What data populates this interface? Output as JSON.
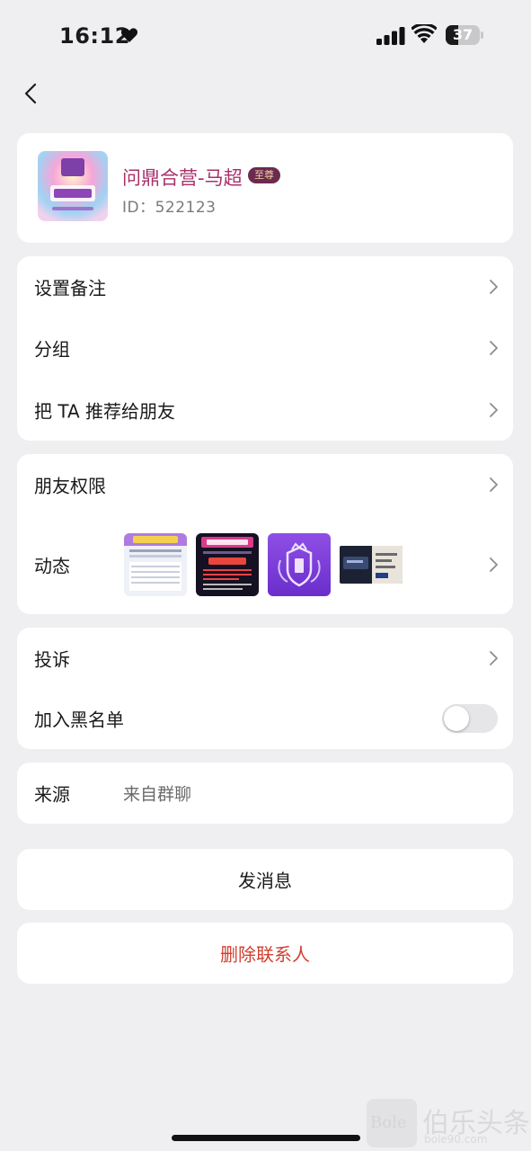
{
  "status_bar": {
    "time": "16:12",
    "battery": "37",
    "battery_level": 0.37
  },
  "profile": {
    "name": "问鼎合营-马超",
    "badge": "至尊",
    "id_text": "ID：522123"
  },
  "settings": [
    {
      "label": "设置备注"
    },
    {
      "label": "分组"
    },
    {
      "label": "把 TA 推荐给朋友"
    }
  ],
  "privacy": {
    "friend_permissions": "朋友权限",
    "moments": "动态"
  },
  "report": {
    "complaint": "投诉",
    "blacklist": "加入黑名单",
    "blacklist_on": false
  },
  "source": {
    "label": "来源",
    "value": "来自群聊"
  },
  "actions": {
    "send_message": "发消息",
    "delete_contact": "删除联系人"
  },
  "colors": {
    "accent_name": "#a8306a",
    "danger": "#d23f2f",
    "background": "#efeff1"
  },
  "watermark": {
    "text": "伯乐头条",
    "url": "bole90.com",
    "logo": "Bole"
  }
}
